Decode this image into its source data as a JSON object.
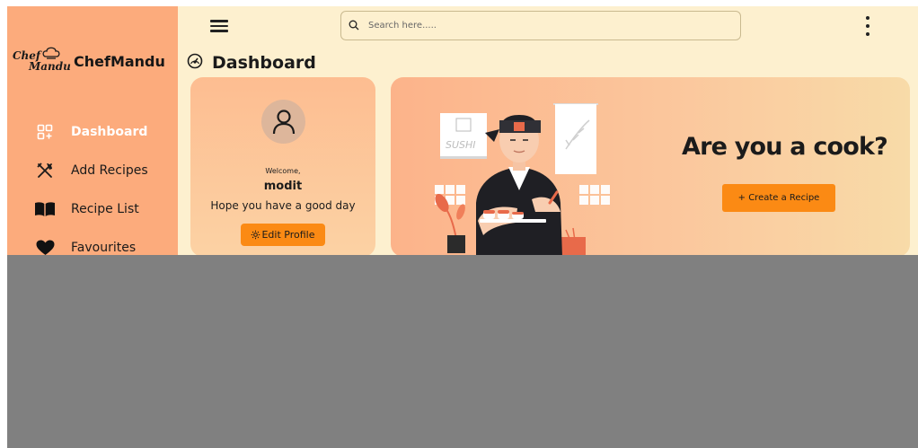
{
  "brand": {
    "logo_line1": "Chef",
    "logo_line2": "Mandu",
    "name": "ChefMandu"
  },
  "nav": {
    "items": [
      {
        "label": "Dashboard",
        "icon": "grid-icon",
        "active": true
      },
      {
        "label": "Add Recipes",
        "icon": "utensils-icon",
        "active": false
      },
      {
        "label": "Recipe List",
        "icon": "book-icon",
        "active": false
      },
      {
        "label": "Favourites",
        "icon": "heart-icon",
        "active": false
      }
    ]
  },
  "topbar": {
    "search_placeholder": "Search here....."
  },
  "page": {
    "title": "Dashboard"
  },
  "profile": {
    "welcome": "Welcome,",
    "username": "modit",
    "greeting": "Hope you have a good day",
    "edit_label": "Edit Profile"
  },
  "hero": {
    "title": "Are you a cook?",
    "create_label": "+ Create a Recipe",
    "sign_text": "SUSHI"
  },
  "colors": {
    "sidebar": "#fcab7c",
    "background": "#fdf0cf",
    "accent": "#fb8a14",
    "active_nav": "#ffffff",
    "overlay": "#808080"
  }
}
